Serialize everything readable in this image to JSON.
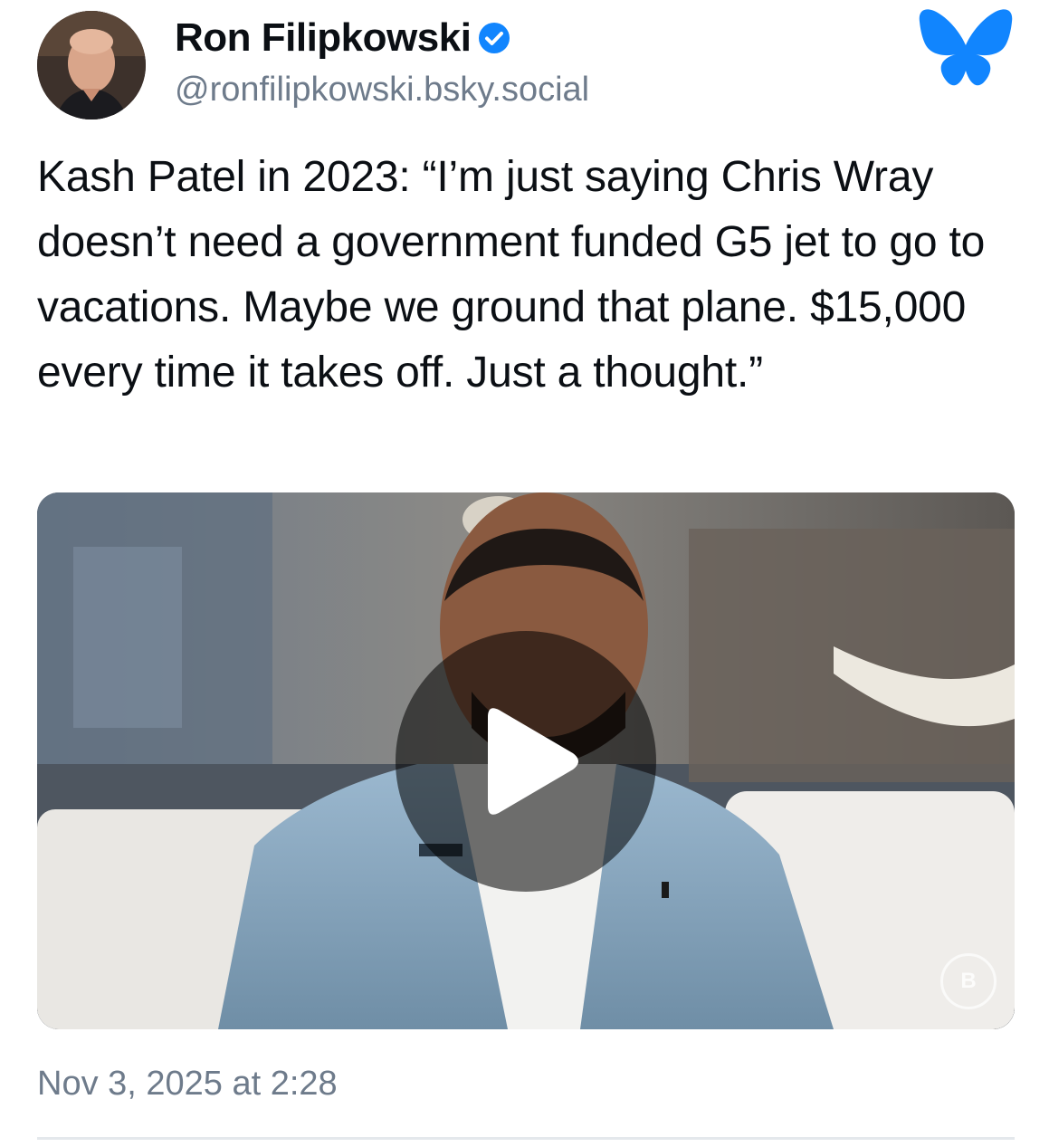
{
  "author": {
    "display_name": "Ron Filipkowski",
    "handle": "@ronfilipkowski.bsky.social",
    "verified_icon": "verified-check-icon"
  },
  "platform": {
    "logo_icon": "bluesky-butterfly-icon",
    "brand_color": "#1185fe"
  },
  "post": {
    "text": "Kash Patel in 2023: “I’m just saying Chris Wray doesn’t need a government funded G5 jet to go to vacations. Maybe we ground that plane. $15,000 every time it takes off. Just a thought.”",
    "timestamp": "Nov 3, 2025 at 2:28"
  },
  "video": {
    "play_icon": "play-icon",
    "watermark_text": "B"
  },
  "colors": {
    "text_primary": "#0b0f14",
    "text_secondary": "#6e7b8b",
    "verified": "#1185fe",
    "divider": "#e4e8ec"
  }
}
